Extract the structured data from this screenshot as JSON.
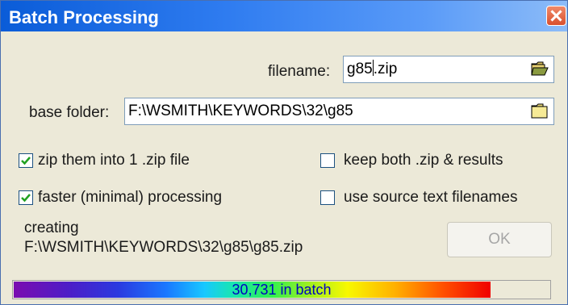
{
  "window": {
    "title": "Batch Processing"
  },
  "filename": {
    "label": "filename:",
    "value_before_caret": "g85",
    "value_after_caret": ".zip"
  },
  "base_folder": {
    "label": "base folder:",
    "value": "F:\\WSMITH\\KEYWORDS\\32\\g85"
  },
  "options": {
    "zip_into_one": {
      "label": "zip them into 1 .zip file",
      "checked": true
    },
    "faster_processing": {
      "label": "faster (minimal) processing",
      "checked": true
    },
    "keep_both": {
      "label": "keep both .zip & results",
      "checked": false
    },
    "use_source_names": {
      "label": "use source text filenames",
      "checked": false
    }
  },
  "status": {
    "line1": "creating",
    "line2": "F:\\WSMITH\\KEYWORDS\\32\\g85\\g85.zip"
  },
  "ok_button": {
    "label": "OK",
    "enabled": false
  },
  "progress": {
    "text": "30,731 in batch",
    "fraction": 0.89
  },
  "icons": {
    "close": "close-icon",
    "folder_open": "folder-open-icon",
    "folder": "folder-icon",
    "check": "checkmark-icon"
  },
  "colors": {
    "title_bar": "#0a5cd8",
    "dialog_bg": "#ece9d8",
    "progress_text": "#0000c0"
  }
}
